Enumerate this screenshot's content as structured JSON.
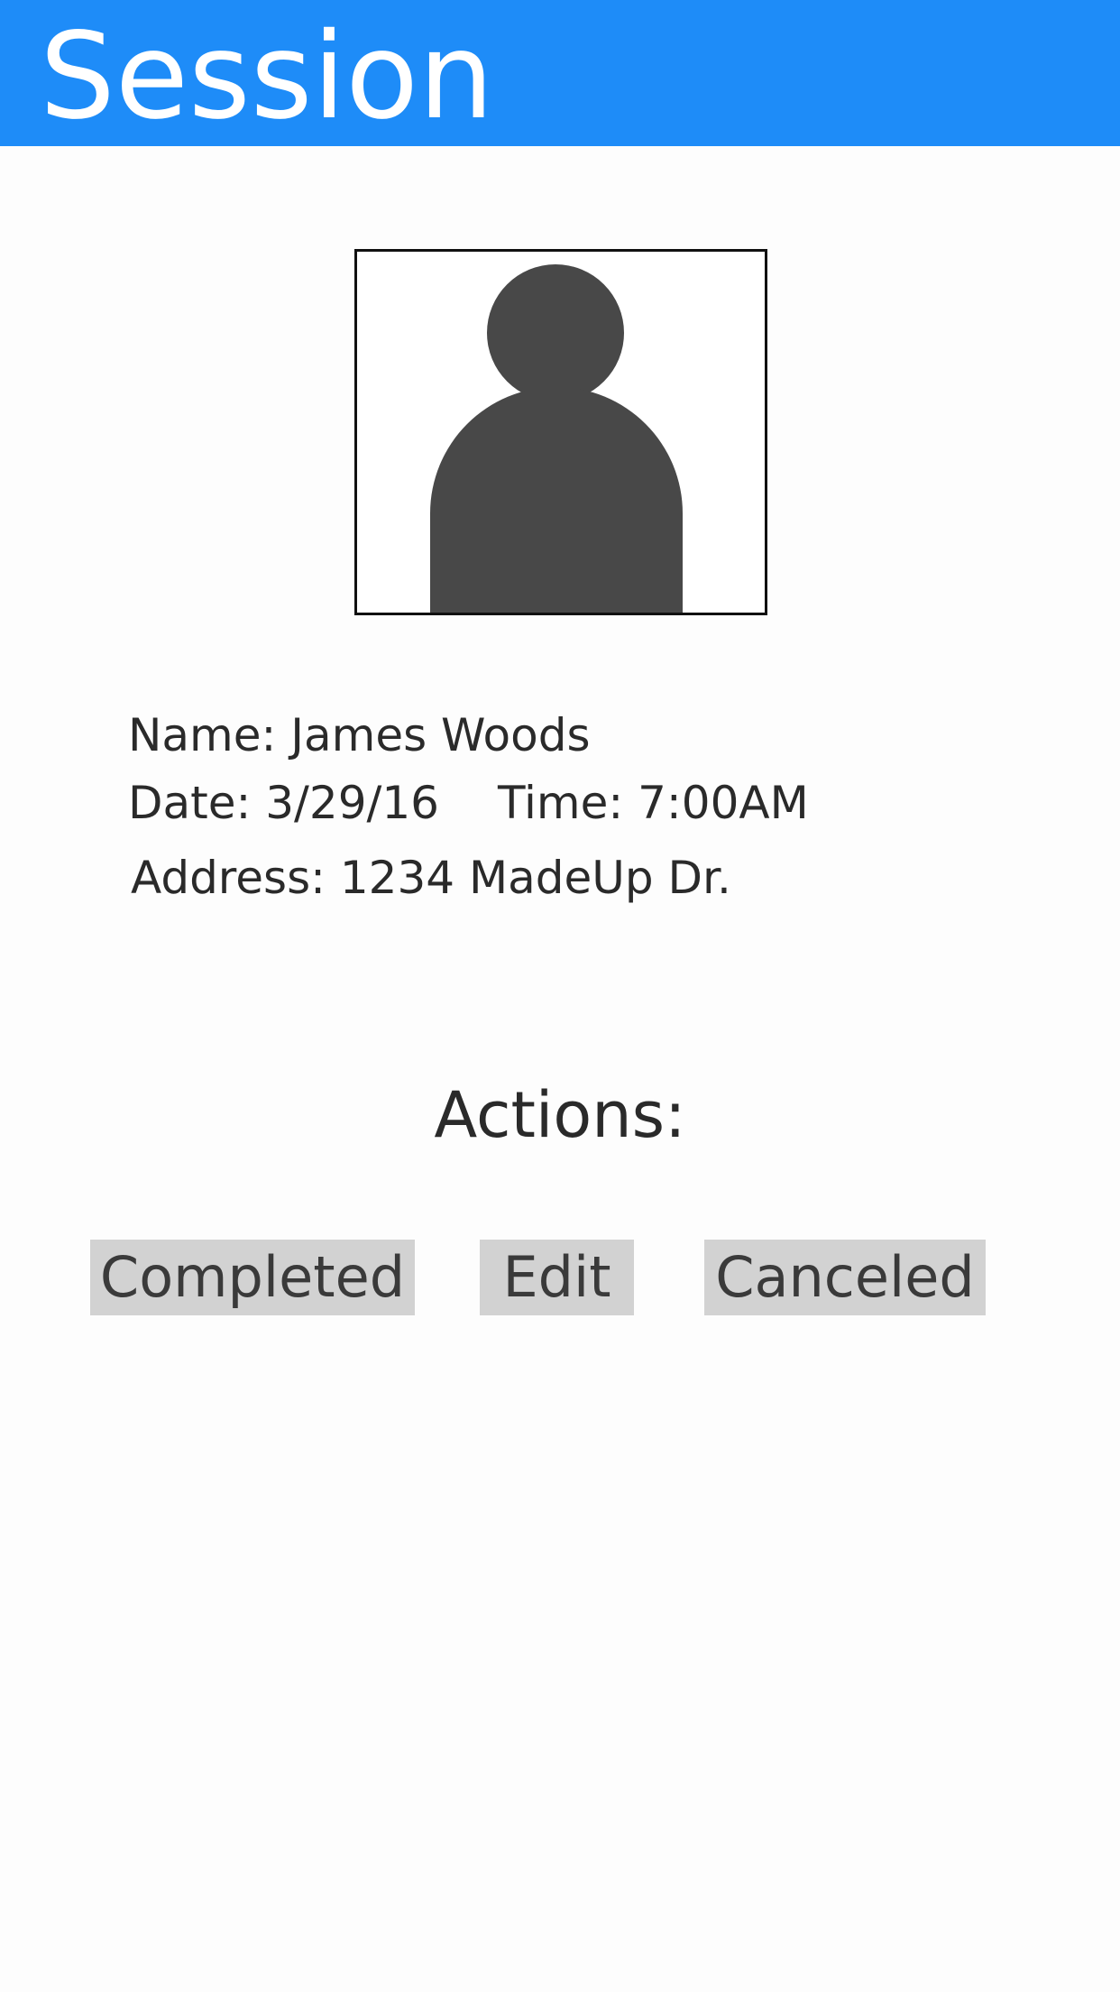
{
  "header": {
    "title": "Session",
    "background_color": "#1e8cf8"
  },
  "profile": {
    "avatar_icon": "person-silhouette-icon",
    "name_line": "Name: James Woods",
    "date_line": "Date: 3/29/16",
    "time_line": "Time: 7:00AM",
    "address_line": "Address: 1234 MadeUp Dr."
  },
  "actions": {
    "heading": "Actions:",
    "buttons": [
      {
        "label": "Completed"
      },
      {
        "label": "Edit"
      },
      {
        "label": "Canceled"
      }
    ],
    "button_color": "#d2d2d2"
  }
}
